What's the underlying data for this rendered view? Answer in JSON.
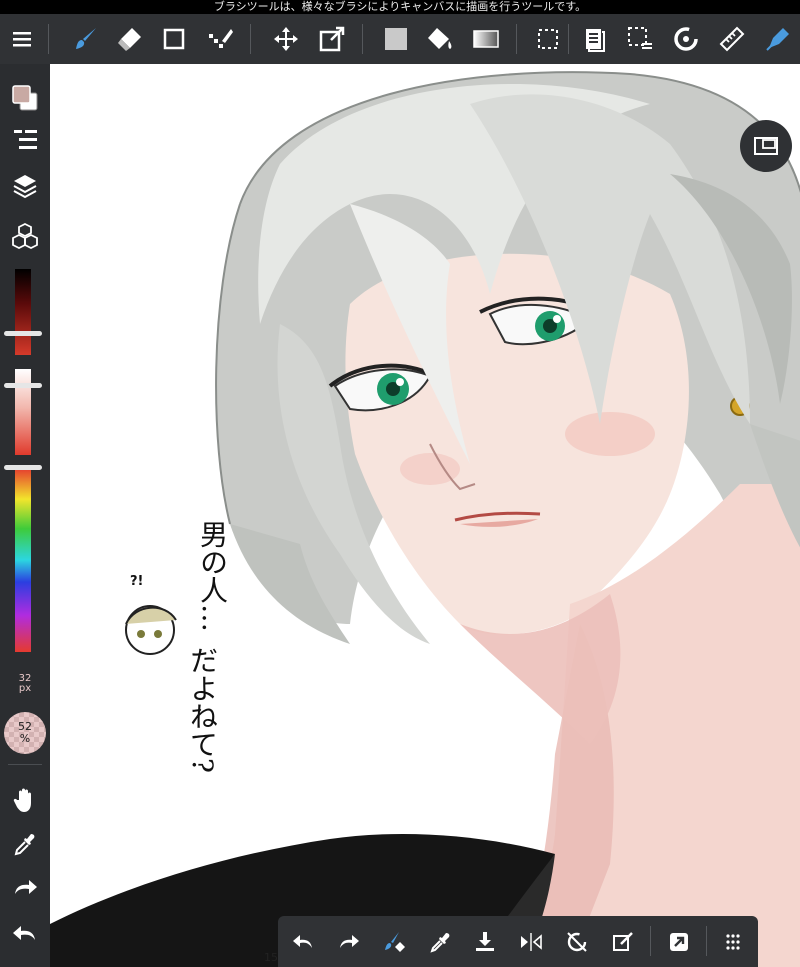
{
  "hint_text": "ブラシツールは、様々なブラシによりキャンバスに描画を行うツールです。",
  "top_toolbar": {
    "tools": [
      {
        "name": "menu",
        "icon": "hamburger-menu-icon"
      },
      {
        "name": "brush",
        "icon": "brush-icon",
        "active": true
      },
      {
        "name": "eraser",
        "icon": "eraser-icon"
      },
      {
        "name": "shape",
        "icon": "rectangle-icon"
      },
      {
        "name": "dot",
        "icon": "dot-pen-icon"
      },
      {
        "name": "move",
        "icon": "move-icon"
      },
      {
        "name": "transform",
        "icon": "transform-icon"
      },
      {
        "name": "fill-color",
        "icon": "fill-square-icon"
      },
      {
        "name": "bucket",
        "icon": "paint-bucket-icon"
      },
      {
        "name": "gradient",
        "icon": "gradient-icon"
      },
      {
        "name": "select",
        "icon": "select-rect-icon"
      },
      {
        "name": "copy",
        "icon": "copy-layer-icon"
      },
      {
        "name": "selection-menu",
        "icon": "selection-menu-icon"
      },
      {
        "name": "rotate",
        "icon": "rotate-icon"
      },
      {
        "name": "ruler",
        "icon": "ruler-icon"
      },
      {
        "name": "material",
        "icon": "pen-nib-icon"
      }
    ]
  },
  "left_toolbar": {
    "colors": {
      "primary": "#c8a9a3",
      "secondary": "#ffffff"
    },
    "brush_size": {
      "value": "32",
      "unit": "px"
    },
    "opacity": {
      "value": "52",
      "unit": "%"
    },
    "accent": "#2d8ed8"
  },
  "canvas": {
    "handwriting": "男の人…だよね?",
    "handwriting_lines": [
      "男の人…",
      "だよねて?"
    ],
    "sticker_exclaim": "?!"
  },
  "bottom_toolbar": {
    "page": "15",
    "tools": [
      "undo-icon",
      "redo-icon",
      "brush-eraser-toggle-icon",
      "eyedropper-icon",
      "save-icon",
      "flip-icon",
      "rotate-reset-icon",
      "clear-icon",
      "export-icon",
      "grid-menu-icon"
    ]
  }
}
